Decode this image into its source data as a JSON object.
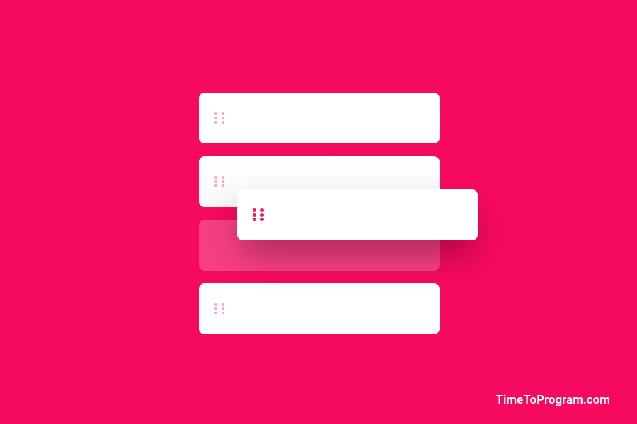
{
  "background_color": "#f50a60",
  "watermark": "TimeToProgram.com",
  "list": {
    "items": [
      {
        "id": 1,
        "dragging": false
      },
      {
        "id": 2,
        "dragging": false
      },
      {
        "id": 3,
        "dragging": true
      },
      {
        "id": 4,
        "dragging": false
      }
    ]
  },
  "drag_handle": {
    "dot_color_light": "#f9a8c9",
    "dot_color_strong": "#e91e63"
  }
}
